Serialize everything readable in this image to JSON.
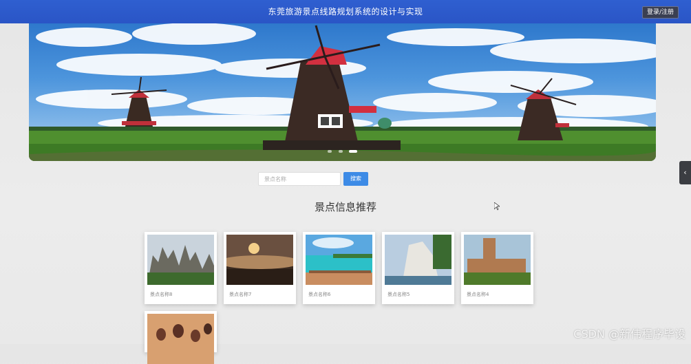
{
  "header": {
    "title": "东莞旅游景点线路规划系统的设计与实现",
    "login_label": "登录/注册"
  },
  "banner": {
    "slides": 3,
    "active_slide": 2
  },
  "side_tab": {
    "icon": "chevron-left-icon",
    "glyph": "‹"
  },
  "search": {
    "placeholder": "景点名称",
    "button_label": "搜索"
  },
  "section": {
    "title": "景点信息推荐"
  },
  "cards": [
    {
      "label": "景点名称8",
      "image": "karst-mountain-peaks"
    },
    {
      "label": "景点名称7",
      "image": "sunset-over-clouds"
    },
    {
      "label": "景点名称6",
      "image": "beach-boardwalk"
    },
    {
      "label": "景点名称5",
      "image": "white-sea-cliffs"
    },
    {
      "label": "景点名称4",
      "image": "medieval-village-tower"
    },
    {
      "label": "",
      "image": "hot-air-balloons"
    }
  ],
  "watermark": "CSDN @新伟程序毕设"
}
